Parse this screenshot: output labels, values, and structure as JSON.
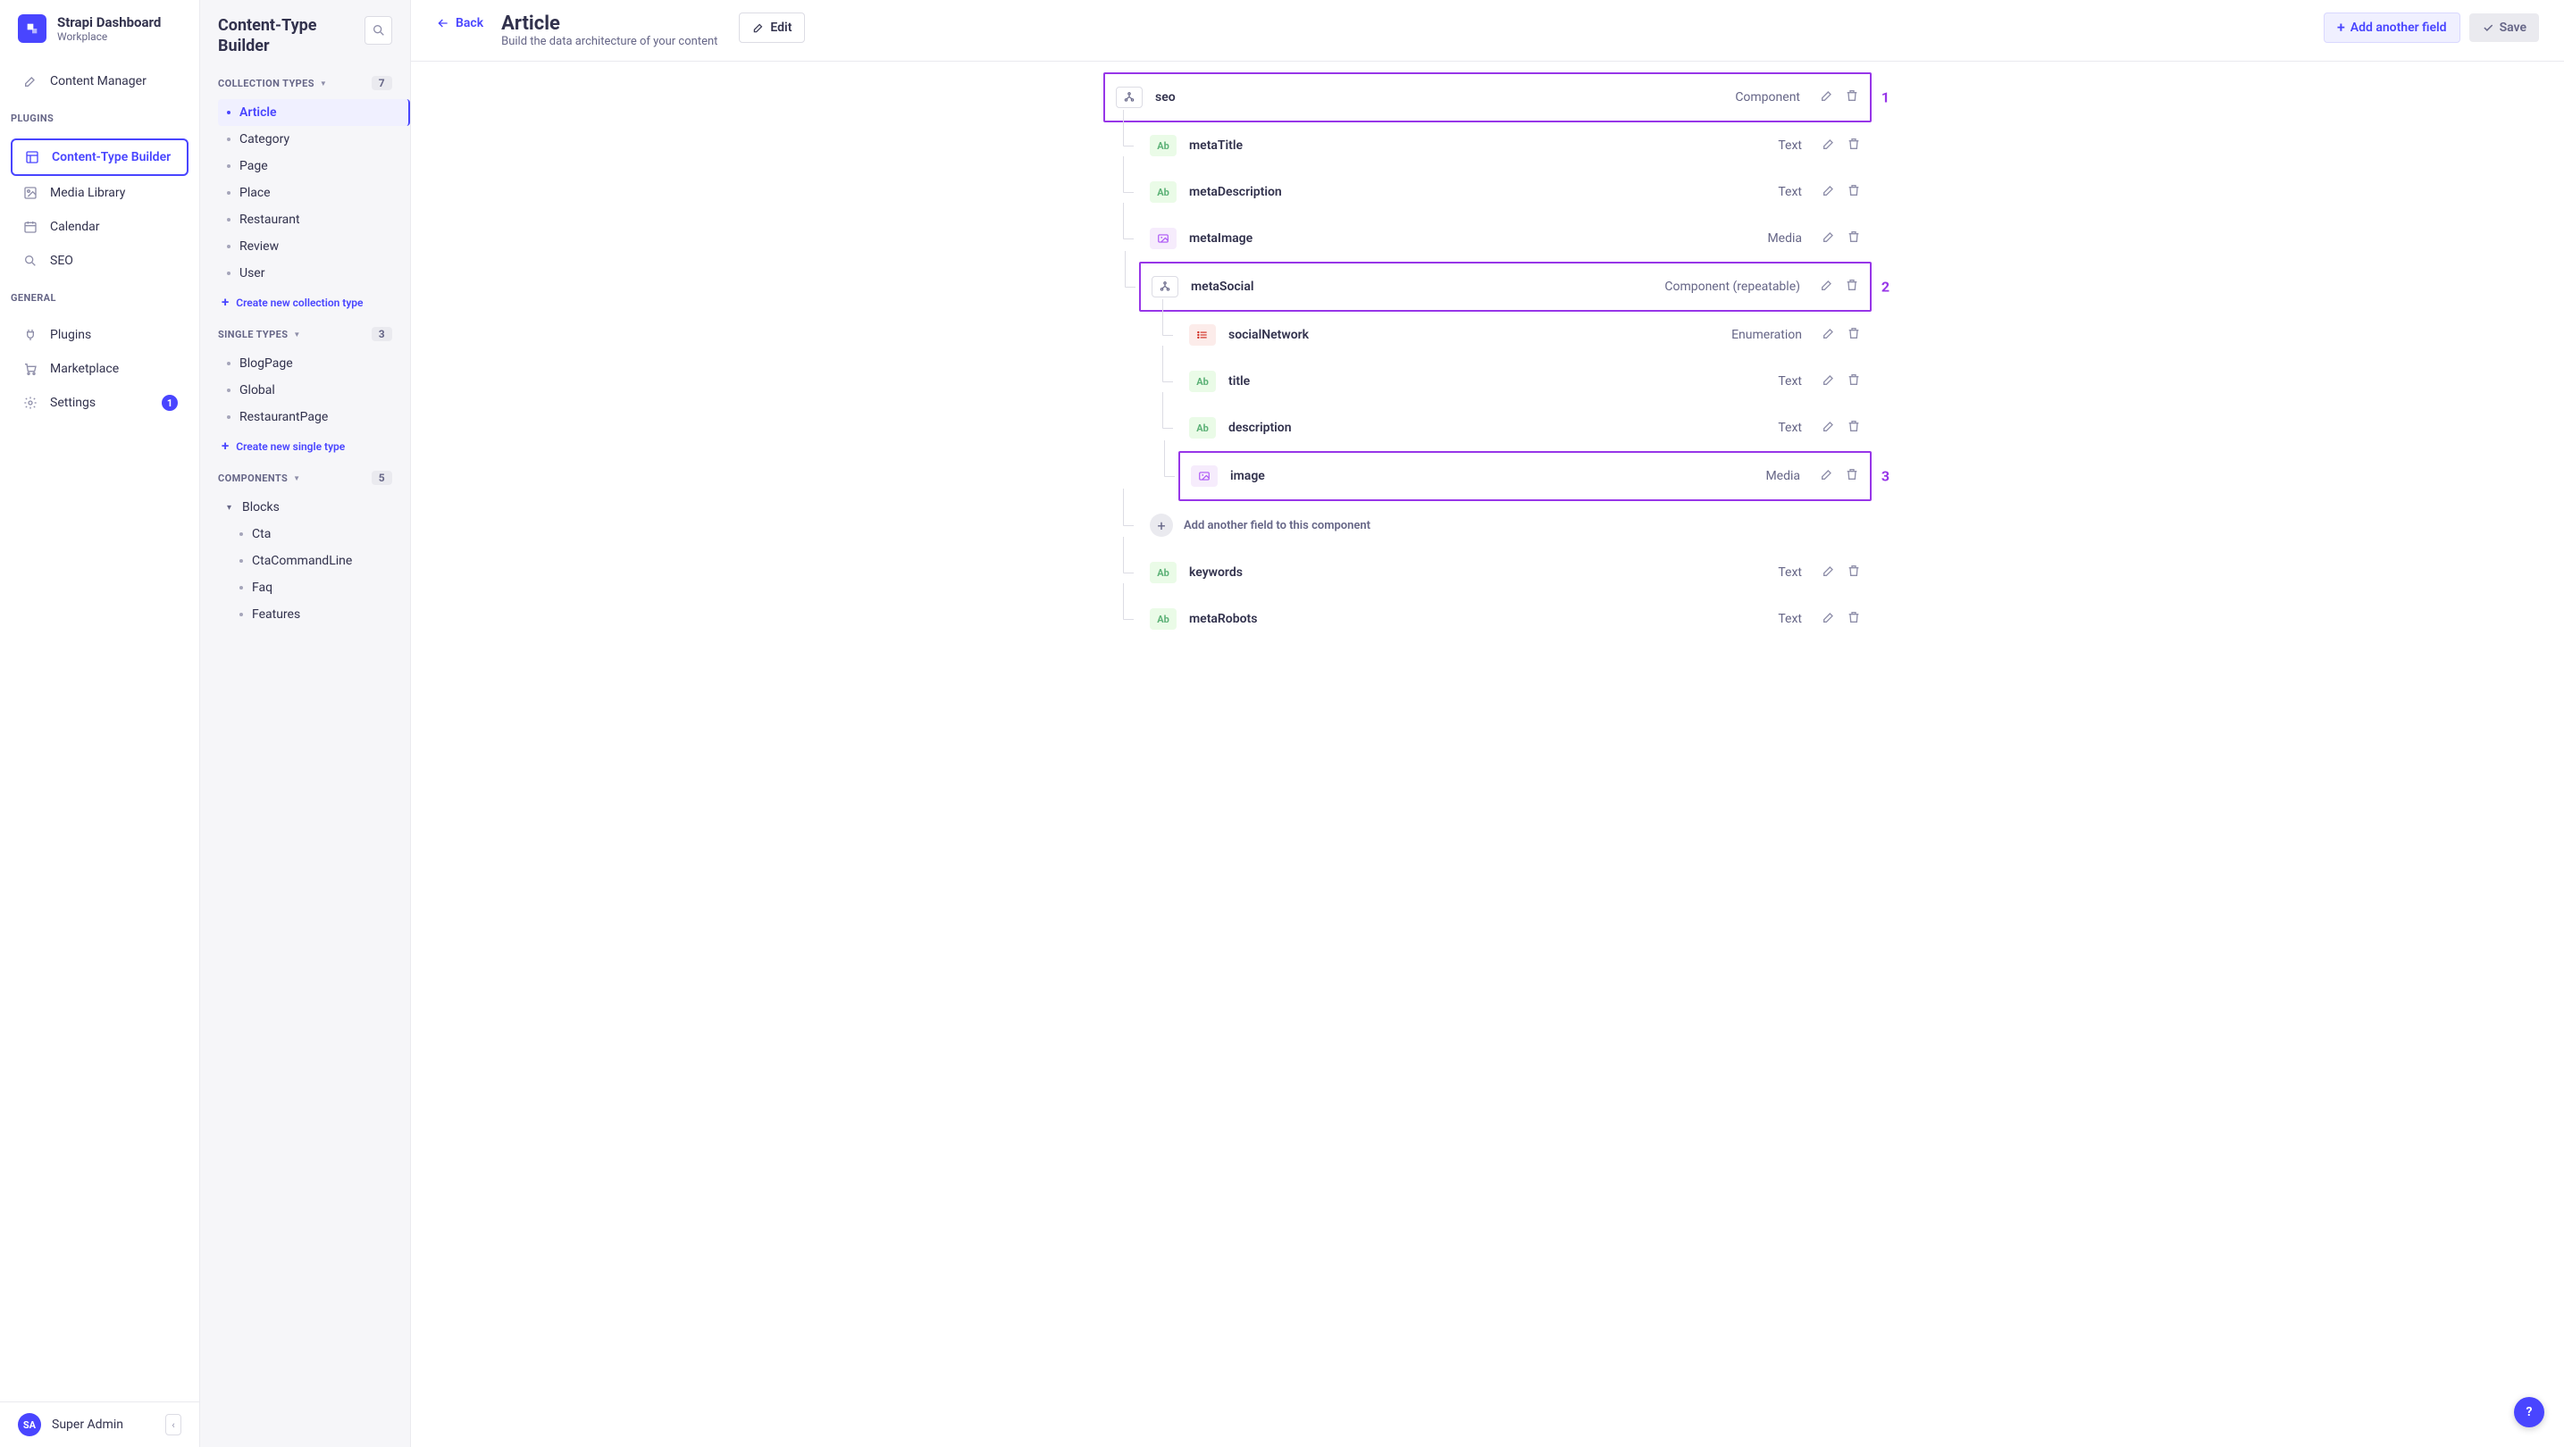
{
  "brand": {
    "title": "Strapi Dashboard",
    "subtitle": "Workplace"
  },
  "nav": {
    "top_items": [
      {
        "label": "Content Manager",
        "icon": "pencil-square-icon"
      }
    ],
    "plugins_label": "PLUGINS",
    "plugin_items": [
      {
        "label": "Content-Type Builder",
        "icon": "layout-icon",
        "active": true
      },
      {
        "label": "Media Library",
        "icon": "image-icon"
      },
      {
        "label": "Calendar",
        "icon": "calendar-icon"
      },
      {
        "label": "SEO",
        "icon": "search-icon"
      }
    ],
    "general_label": "GENERAL",
    "general_items": [
      {
        "label": "Plugins",
        "icon": "plug-icon"
      },
      {
        "label": "Marketplace",
        "icon": "cart-icon"
      },
      {
        "label": "Settings",
        "icon": "gear-icon",
        "badge": "1"
      }
    ],
    "user": {
      "initials": "SA",
      "name": "Super Admin"
    }
  },
  "sidebar": {
    "title": "Content-Type Builder",
    "collection": {
      "label": "COLLECTION TYPES",
      "count": "7",
      "items": [
        "Article",
        "Category",
        "Page",
        "Place",
        "Restaurant",
        "Review",
        "User"
      ],
      "active": "Article",
      "create": "Create new collection type"
    },
    "single": {
      "label": "SINGLE TYPES",
      "count": "3",
      "items": [
        "BlogPage",
        "Global",
        "RestaurantPage"
      ],
      "create": "Create new single type"
    },
    "components": {
      "label": "COMPONENTS",
      "count": "5",
      "groups": [
        {
          "name": "Blocks",
          "expanded": true,
          "items": [
            "Cta",
            "CtaCommandLine",
            "Faq",
            "Features"
          ]
        }
      ]
    }
  },
  "header": {
    "back": "Back",
    "title": "Article",
    "subtitle": "Build the data architecture of your content",
    "edit": "Edit",
    "add": "Add another field",
    "save": "Save"
  },
  "fields": {
    "seo": {
      "name": "seo",
      "type": "Component",
      "callout": "1"
    },
    "seo_children": [
      {
        "name": "metaTitle",
        "type": "Text",
        "badge": "Ab",
        "badgeClass": "badge-text"
      },
      {
        "name": "metaDescription",
        "type": "Text",
        "badge": "Ab",
        "badgeClass": "badge-text"
      },
      {
        "name": "metaImage",
        "type": "Media",
        "badge": "img",
        "badgeClass": "badge-media"
      }
    ],
    "metaSocial": {
      "name": "metaSocial",
      "type": "Component (repeatable)",
      "callout": "2"
    },
    "metaSocial_children": [
      {
        "name": "socialNetwork",
        "type": "Enumeration",
        "badge": "list",
        "badgeClass": "badge-enum"
      },
      {
        "name": "title",
        "type": "Text",
        "badge": "Ab",
        "badgeClass": "badge-text"
      },
      {
        "name": "description",
        "type": "Text",
        "badge": "Ab",
        "badgeClass": "badge-text"
      },
      {
        "name": "image",
        "type": "Media",
        "badge": "img",
        "badgeClass": "badge-media",
        "highlight": true,
        "callout": "3"
      }
    ],
    "add_to_component": "Add another field to this component",
    "tail": [
      {
        "name": "keywords",
        "type": "Text",
        "badge": "Ab",
        "badgeClass": "badge-text"
      },
      {
        "name": "metaRobots",
        "type": "Text",
        "badge": "Ab",
        "badgeClass": "badge-text"
      }
    ]
  }
}
